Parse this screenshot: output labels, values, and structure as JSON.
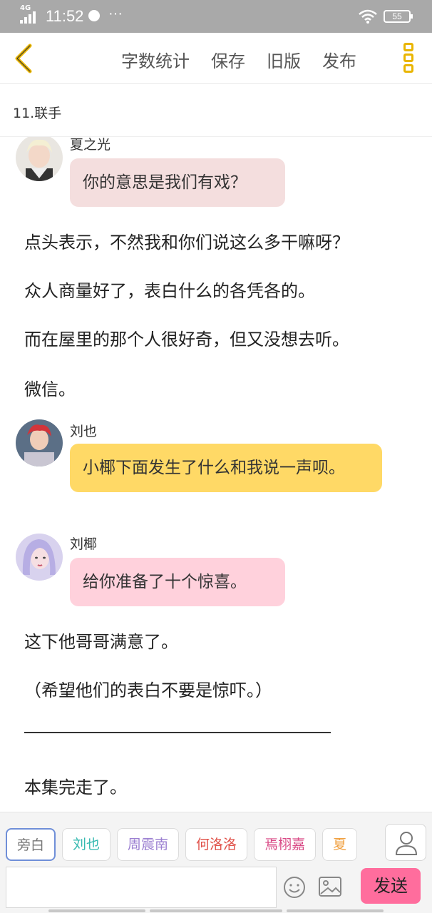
{
  "status_bar": {
    "network": "4G",
    "time": "11:52",
    "dots": "···",
    "battery": "55"
  },
  "toolbar": {
    "back_icon": "chevron-left-icon",
    "items": [
      "字数统计",
      "保存",
      "旧版",
      "发布"
    ],
    "more_icon": "more-vertical-icon",
    "accent_color": "#e9b500"
  },
  "chapter": {
    "title": "11.联手"
  },
  "content": {
    "messages": [
      {
        "speaker": "夏之光",
        "text": "你的意思是我们有戏？",
        "bubble_color": "#f4dede"
      },
      {
        "speaker": "刘也",
        "text": "小椰下面发生了什么和我说一声呗。",
        "bubble_color": "#ffd966"
      },
      {
        "speaker": "刘椰",
        "text": "给你准备了十个惊喜。",
        "bubble_color": "#ffd1dc"
      }
    ],
    "narration": [
      "点头表示，不然我和你们说这么多干嘛呀？",
      "众人商量好了，表白什么的各凭各的。",
      "而在屋里的那个人很好奇，但又没想去听。",
      "微信。",
      "这下他哥哥满意了。",
      "（希望他们的表白不要是惊吓。）",
      "本集完走了。"
    ]
  },
  "bottom_bar": {
    "characters": [
      {
        "name": "旁白",
        "color": "#777777"
      },
      {
        "name": "刘也",
        "color": "#35b9b0"
      },
      {
        "name": "周震南",
        "color": "#9b7fd1"
      },
      {
        "name": "何洛洛",
        "color": "#e0524a"
      },
      {
        "name": "焉栩嘉",
        "color": "#d94a86"
      },
      {
        "name": "夏",
        "color": "#f0a040"
      }
    ],
    "person_icon": "person-icon",
    "input_value": "",
    "emoji_icon": "emoji-icon",
    "image_icon": "image-icon",
    "send_label": "发送",
    "send_color": "#ff6d9d"
  }
}
